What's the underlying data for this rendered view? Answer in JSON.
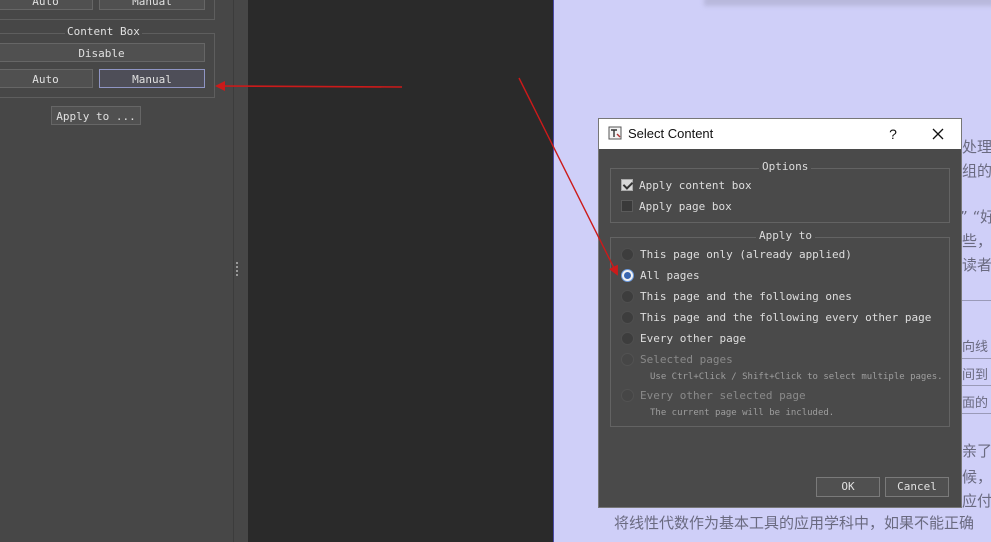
{
  "sidebar": {
    "top_auto_label": "Auto",
    "top_manual_label": "Manual",
    "content_box_title": "Content Box",
    "disable_label": "Disable",
    "auto_label": "Auto",
    "manual_label": "Manual",
    "apply_to_label": "Apply to ..."
  },
  "document": {
    "fragments": [
      "处理",
      "组的",
      "” “好",
      "些，",
      "读者",
      "向线",
      "间到",
      "面的",
      "亲了",
      "候，",
      "应付",
      "将线性代数作为基本工具的应用学科中，如果不能正确"
    ]
  },
  "dialog": {
    "title": "Select Content",
    "help_label": "?",
    "options_title": "Options",
    "apply_content_box": "Apply content box",
    "apply_page_box": "Apply page box",
    "apply_to_title": "Apply to",
    "radio_this_page_only": "This page only (already applied)",
    "radio_all_pages": "All pages",
    "radio_following": "This page and the following ones",
    "radio_following_every_other": "This page and the following every other page",
    "radio_every_other": "Every other page",
    "radio_selected": "Selected pages",
    "selected_hint": "Use Ctrl+Click / Shift+Click to select multiple pages.",
    "radio_every_other_selected": "Every other selected page",
    "every_other_selected_hint": "The current page will be included.",
    "ok_label": "OK",
    "cancel_label": "Cancel",
    "selected_option": "All pages",
    "apply_content_box_checked": true,
    "apply_page_box_checked": false
  },
  "colors": {
    "annotation_arrow": "#cc1a1a",
    "page_background": "#cfcff8"
  }
}
